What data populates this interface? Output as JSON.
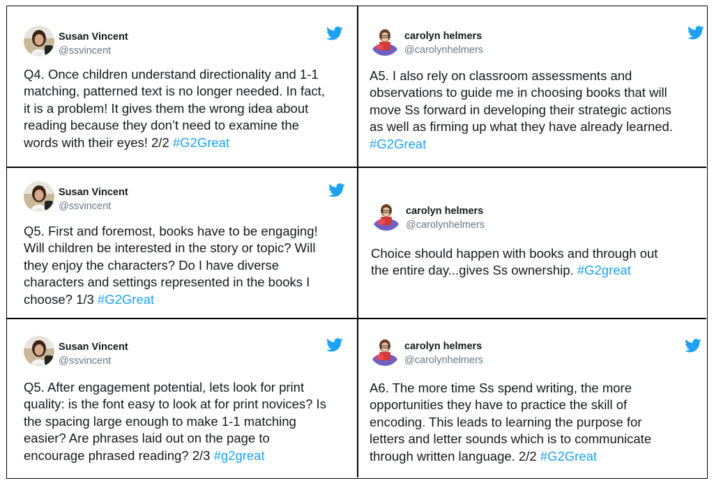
{
  "colors": {
    "hashtag": "#1DA1F2",
    "bird": "#1DA1F2",
    "handle": "#657786",
    "text": "#14171A"
  },
  "icons": {
    "brand": "twitter-bird-icon"
  },
  "tweets": [
    {
      "name": "Susan Vincent",
      "handle": "@ssvincent",
      "text": "Q4. Once children understand directionality and 1-1\nmatching, patterned text is no longer needed. In fact,\nit is a problem! It gives them the wrong idea about\nreading because they don’t need to examine the\nwords with their eyes! 2/2  ",
      "hashtag": "#G2Great"
    },
    {
      "name": "carolyn helmers",
      "handle": "@carolynhelmers",
      "text": "A5. I also rely on classroom assessments and\nobservations to guide me in choosing books that will\nmove Ss forward in developing their strategic actions\nas well as firming up what they have already learned.\n",
      "hashtag": "#G2Great"
    },
    {
      "name": "Susan Vincent",
      "handle": "@ssvincent",
      "text": "Q5. First and foremost, books have to be engaging!\nWill children be interested in the story or topic? Will\nthey enjoy the characters? Do I have diverse\ncharacters and settings represented in the books I\nchoose? 1/3  ",
      "hashtag": "#G2Great"
    },
    {
      "name": "carolyn helmers",
      "handle": "@carolynhelmers",
      "text": "Choice should happen with books and through out\nthe entire day...gives Ss ownership. ",
      "hashtag": "#G2great"
    },
    {
      "name": "Susan Vincent",
      "handle": "@ssvincent",
      "text": "Q5. After engagement potential, lets look for print\nquality: is the font easy to look at for print novices? Is\nthe spacing large enough to make 1-1 matching\neasier? Are phrases laid out on the page to\nencourage phrased reading? 2/3  ",
      "hashtag": "#g2great"
    },
    {
      "name": "carolyn helmers",
      "handle": "@carolynhelmers",
      "text": "A6. The more time Ss spend writing, the more\nopportunities they have to practice the skill of\nencoding. This leads to learning the purpose for\nletters and letter sounds which is to communicate\nthrough written language. 2/2 ",
      "hashtag": "#G2Great"
    }
  ]
}
